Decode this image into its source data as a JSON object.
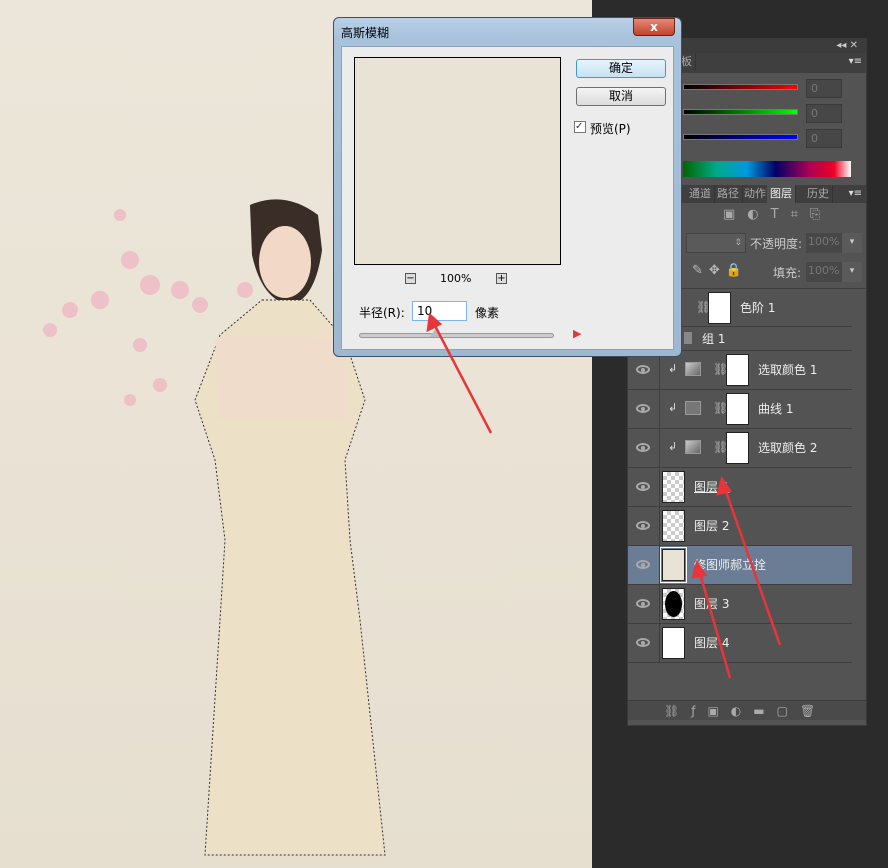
{
  "dialog": {
    "title": "高斯模糊",
    "close": "x",
    "ok": "确定",
    "cancel": "取消",
    "preview_label": "预览(P)",
    "preview_checked": true,
    "zoom": "100%",
    "zoom_out": "−",
    "zoom_in": "+",
    "radius_label": "半径(R):",
    "radius_value": "10",
    "unit": "像素"
  },
  "color_panel": {
    "tab_partial": "板",
    "r": "0",
    "g": "0",
    "b": "0"
  },
  "tabs": [
    "通道",
    "路径",
    "动作",
    "图层",
    "历史"
  ],
  "layers_panel": {
    "opacity_label": "不透明度:",
    "opacity": "100%",
    "fill_label": "填充:",
    "fill": "100%",
    "layers": [
      {
        "name": "色阶 1",
        "type": "adjustment"
      },
      {
        "name": "组 1",
        "type": "group"
      },
      {
        "name": "选取颜色 1",
        "type": "adjustment"
      },
      {
        "name": "曲线 1",
        "type": "adjustment"
      },
      {
        "name": "选取颜色 2",
        "type": "adjustment"
      },
      {
        "name": "图层 1",
        "type": "pixel"
      },
      {
        "name": "图层 2",
        "type": "pixel"
      },
      {
        "name": "修图师郝立拴",
        "type": "pixel",
        "selected": true
      },
      {
        "name": "图层 3",
        "type": "pixel"
      },
      {
        "name": "图层 4",
        "type": "pixel"
      }
    ]
  },
  "colors": {
    "arrow": "#e8353a",
    "selected_row": "#6a7d94"
  }
}
